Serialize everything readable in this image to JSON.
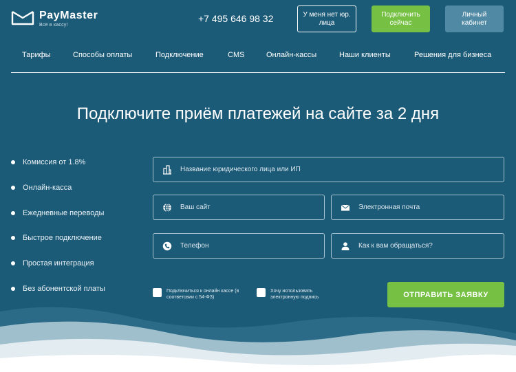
{
  "header": {
    "logo_name": "PayMaster",
    "logo_tagline": "Всё в кассу!",
    "phone": "+7 495 646 98 32",
    "no_legal_button": "У меня нет юр. лица",
    "connect_button": "Подключить сейчас",
    "cabinet_button": "Личный кабинет"
  },
  "nav": {
    "items": [
      "Тарифы",
      "Способы оплаты",
      "Подключение",
      "CMS",
      "Онлайн-кассы",
      "Наши клиенты",
      "Решения для бизнеса"
    ]
  },
  "hero": {
    "headline": "Подключите приём платежей на сайте за 2 дня"
  },
  "features": [
    "Комиссия от 1.8%",
    "Онлайн-касса",
    "Ежедневные переводы",
    "Быстрое подключение",
    "Простая интеграция",
    "Без абонентской платы"
  ],
  "form": {
    "company_placeholder": "Название юридического лица или ИП",
    "site_placeholder": "Ваш сайт",
    "email_placeholder": "Электронная почта",
    "phone_placeholder": "Телефон",
    "name_placeholder": "Как к вам обращаться?",
    "checkbox_kassa": "Подключиться к онлайн кассе (в соответсвии с 54-ФЗ)",
    "checkbox_signature": "Хочу использовать электронную подпись",
    "submit_label": "ОТПРАВИТЬ ЗАЯВКУ"
  },
  "colors": {
    "background": "#1c5b78",
    "accent_green": "#76c043",
    "cabinet_button": "#4f89a3"
  },
  "icons": {
    "company": "building-icon",
    "site": "globe-icon",
    "email": "envelope-icon",
    "phone": "phone-icon",
    "name": "user-icon"
  }
}
